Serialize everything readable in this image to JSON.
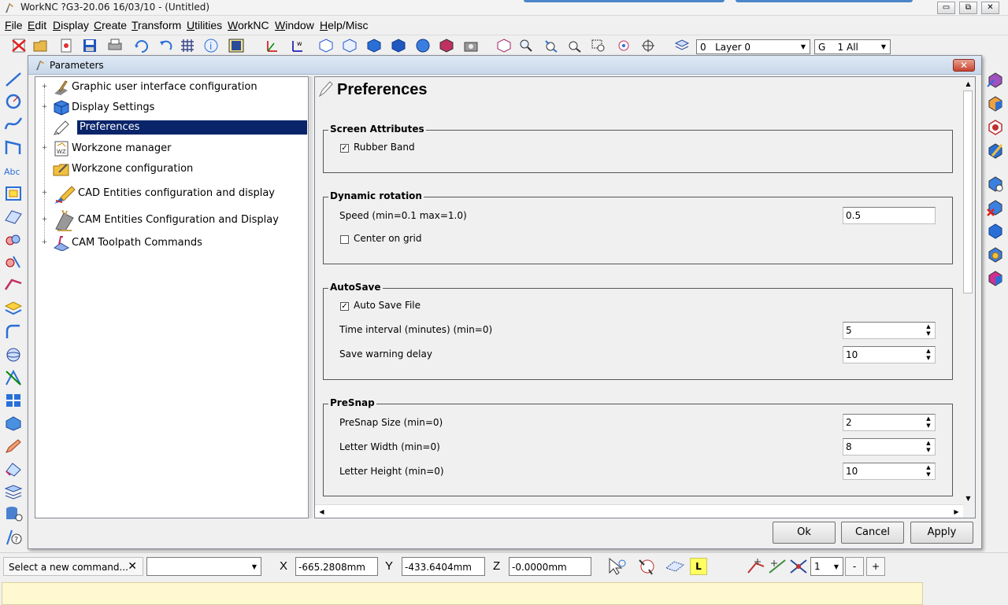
{
  "app": {
    "title": "WorkNC ?G3-20.06  16/03/10 - (Untitled)",
    "minimize_glyph": "▭",
    "restore_glyph": "⧉",
    "close_glyph": "✕"
  },
  "menu": [
    "File",
    "Edit",
    "Display",
    "Create",
    "Transform",
    "Utilities",
    "WorkNC",
    "Window",
    "Help/Misc"
  ],
  "toolbar": {
    "layer_combo": "0   Layer 0",
    "group_combo": "G    1 All"
  },
  "dialog": {
    "title": "Parameters",
    "close_glyph": "✕",
    "tree": [
      {
        "label": "Graphic user interface configuration",
        "expandable": true,
        "selected": false,
        "icon": "gui-config-icon"
      },
      {
        "label": "Display Settings",
        "expandable": true,
        "selected": false,
        "icon": "display-settings-icon"
      },
      {
        "label": "Preferences",
        "expandable": false,
        "selected": true,
        "icon": "preferences-icon"
      },
      {
        "label": "Workzone manager",
        "expandable": true,
        "selected": false,
        "icon": "workzone-manager-icon"
      },
      {
        "label": "Workzone configuration",
        "expandable": false,
        "selected": false,
        "icon": "workzone-config-icon"
      },
      {
        "label": "CAD Entities configuration and display",
        "expandable": true,
        "selected": false,
        "icon": "cad-entities-icon"
      },
      {
        "label": "CAM Entities Configuration and Display",
        "expandable": true,
        "selected": false,
        "icon": "cam-entities-icon"
      },
      {
        "label": "CAM Toolpath Commands",
        "expandable": true,
        "selected": false,
        "icon": "cam-toolpath-icon"
      }
    ],
    "content": {
      "heading": "Preferences",
      "screen_attributes": {
        "title": "Screen Attributes",
        "rubber_band_label": "Rubber Band",
        "rubber_band_checked": true
      },
      "dynamic_rotation": {
        "title": "Dynamic rotation",
        "speed_label": "Speed (min=0.1 max=1.0)",
        "speed_value": "0.5",
        "center_on_grid_label": "Center on grid",
        "center_on_grid_checked": false
      },
      "autosave": {
        "title": "AutoSave",
        "auto_save_label": "Auto Save File",
        "auto_save_checked": true,
        "time_interval_label": "Time interval (minutes) (min=0)",
        "time_interval_value": "5",
        "warning_delay_label": "Save warning delay",
        "warning_delay_value": "10"
      },
      "presnap": {
        "title": "PreSnap",
        "size_label": "PreSnap Size (min=0)",
        "size_value": "2",
        "letter_width_label": "Letter Width (min=0)",
        "letter_width_value": "8",
        "letter_height_label": "Letter Height (min=0)",
        "letter_height_value": "10"
      }
    },
    "buttons": {
      "ok": "Ok",
      "cancel": "Cancel",
      "apply": "Apply"
    }
  },
  "command_bar": {
    "prompt": "Select a new command...",
    "prompt_clear": "✕",
    "x_label": "X",
    "x_value": "-665.2808mm",
    "y_label": "Y",
    "y_value": "-433.6404mm",
    "z_label": "Z",
    "z_value": "-0.0000mm",
    "l_badge": "L",
    "step_value": "1",
    "minus": "-",
    "plus": "+"
  },
  "colors": {
    "selection": "#0a246a",
    "accent_blue": "#2a6fd6",
    "status_yellow": "#fff8d0"
  }
}
